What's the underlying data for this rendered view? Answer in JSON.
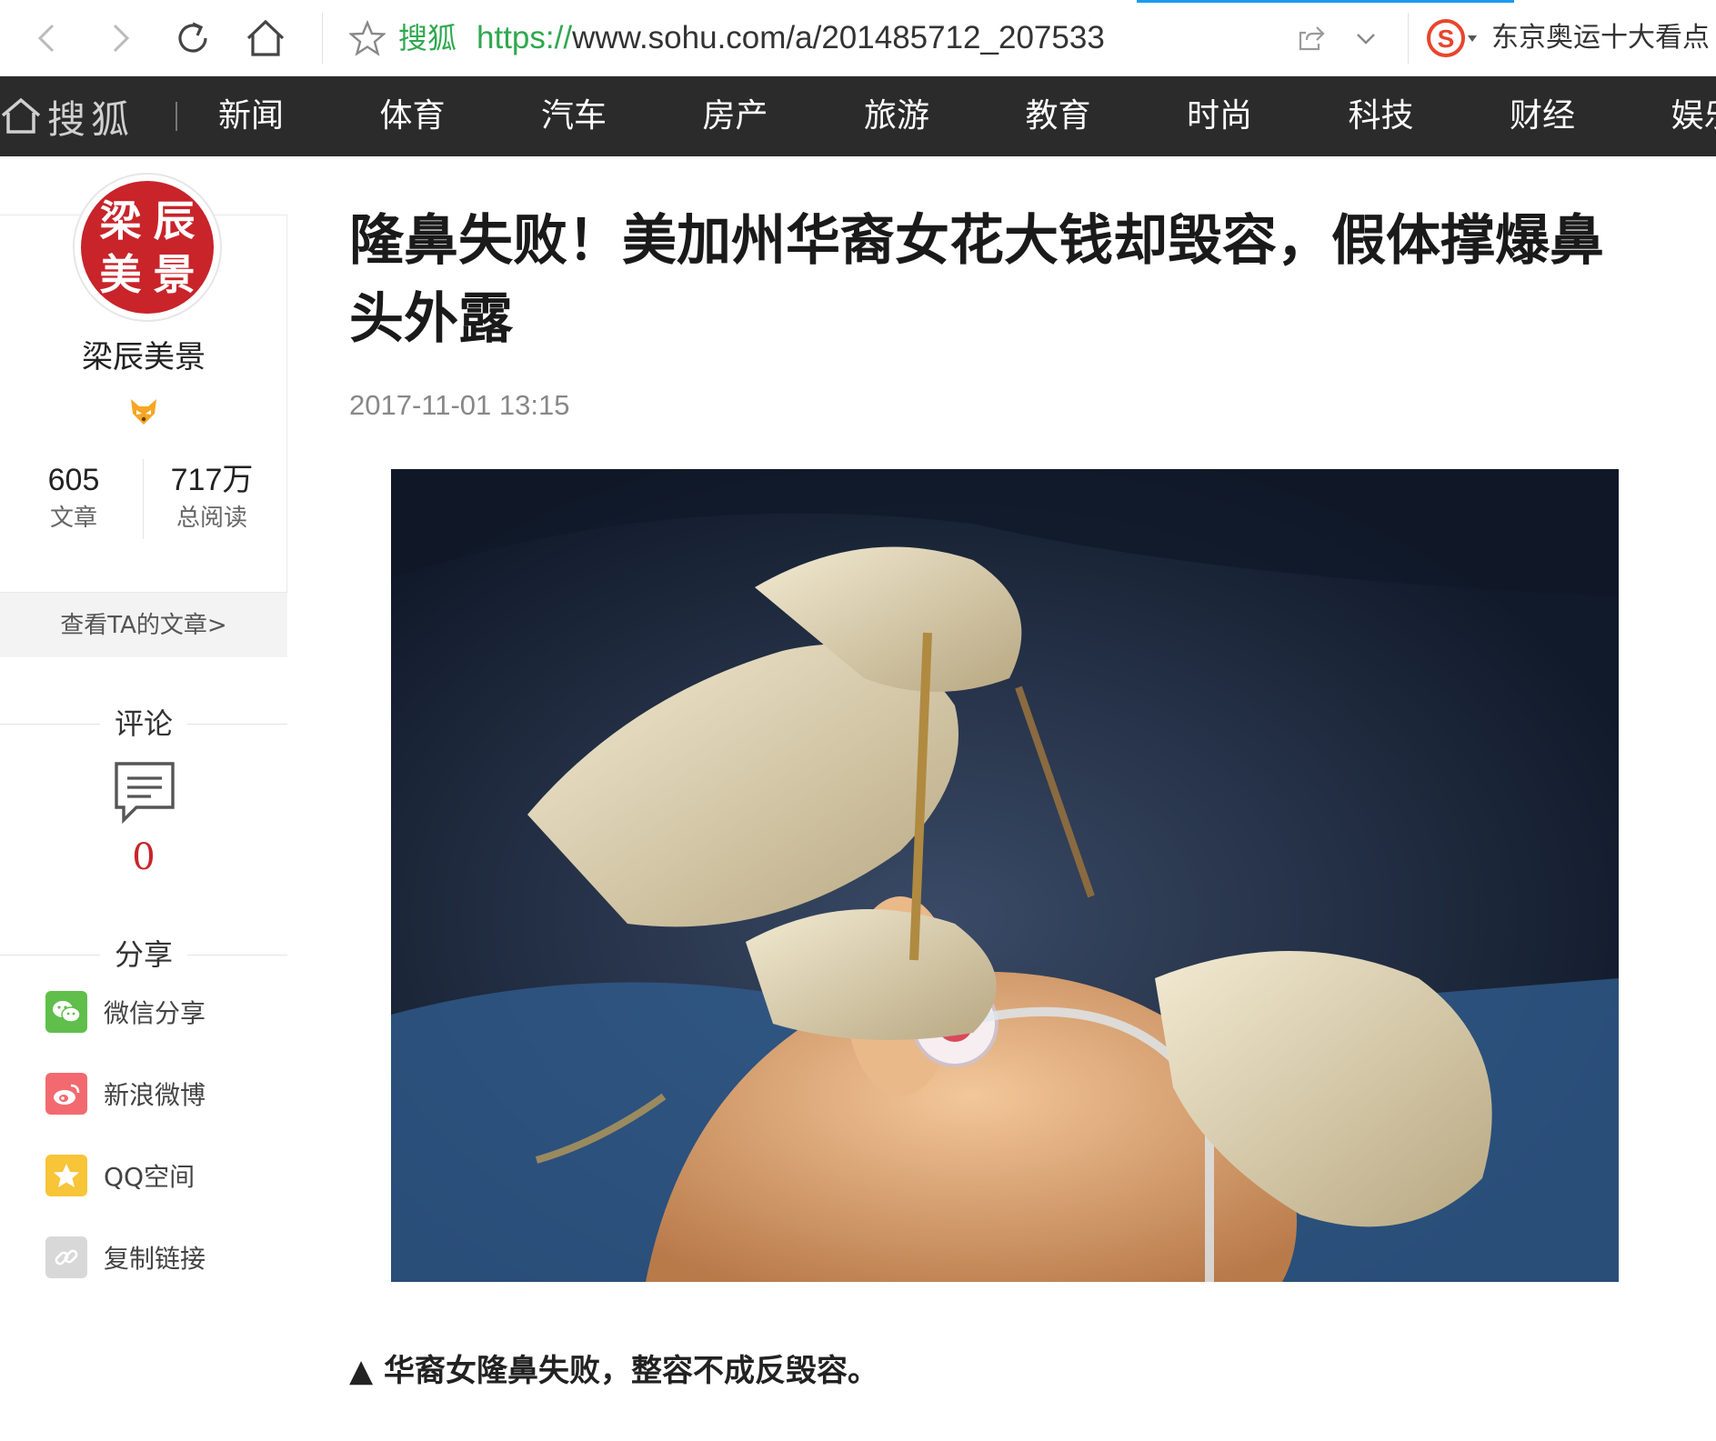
{
  "browser": {
    "site_name": "搜狐",
    "url_protocol": "https://",
    "url_rest": "www.sohu.com/a/201485712_207533",
    "hot_search": "东京奥运十大看点"
  },
  "channel_nav": {
    "logo": "搜狐",
    "items": [
      "新闻",
      "体育",
      "汽车",
      "房产",
      "旅游",
      "教育",
      "时尚",
      "科技",
      "财经",
      "娱乐"
    ]
  },
  "author": {
    "avatar_chars": [
      "梁",
      "辰",
      "美",
      "景"
    ],
    "name": "梁辰美景",
    "articles_count": "605",
    "articles_label": "文章",
    "reads_count": "717万",
    "reads_label": "总阅读",
    "view_articles": "查看TA的文章>"
  },
  "comments": {
    "title": "评论",
    "count": "0"
  },
  "share": {
    "title": "分享",
    "items": [
      {
        "label": "微信分享",
        "icon": "wechat-icon",
        "color": "#5fbf4a"
      },
      {
        "label": "新浪微博",
        "icon": "weibo-icon",
        "color": "#f26a70"
      },
      {
        "label": "QQ空间",
        "icon": "qzone-icon",
        "color": "#f8c438"
      },
      {
        "label": "复制链接",
        "icon": "link-icon",
        "color": "#d8d8d8"
      }
    ]
  },
  "article": {
    "title": "隆鼻失败！美加州华裔女花大钱却毁容，假体撑爆鼻头外露",
    "time": "2017-11-01 13:15",
    "caption": "▲ 华裔女隆鼻失败，整容不成反毁容。"
  },
  "colors": {
    "accent_red": "#c8242a",
    "nav_bg": "#2b2b2b",
    "url_green": "#2fa84f"
  }
}
